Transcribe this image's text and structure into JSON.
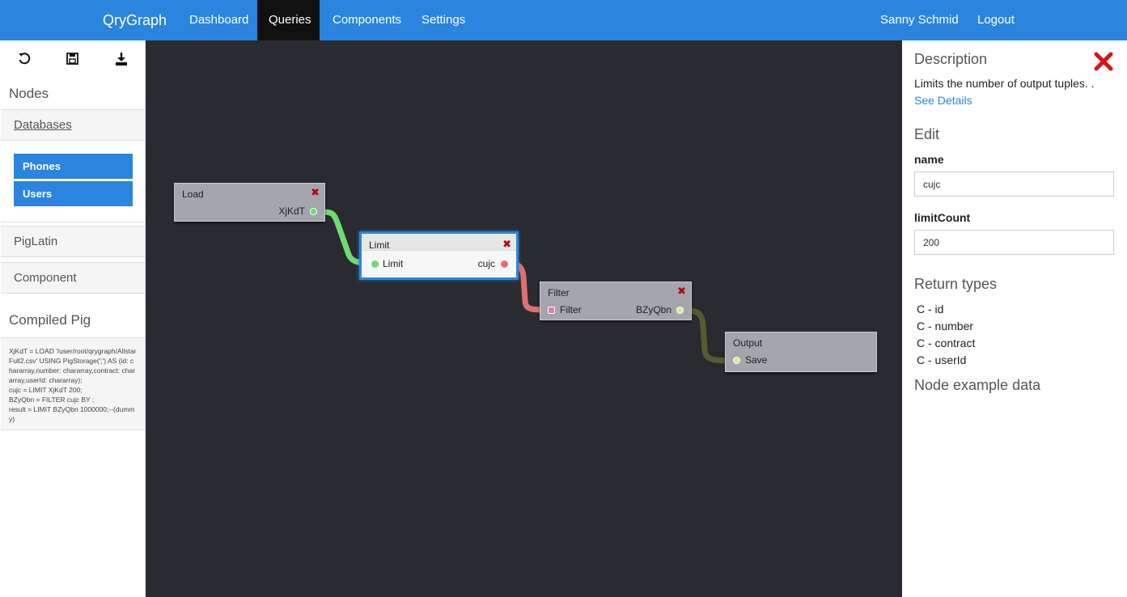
{
  "nav": {
    "brand": "QryGraph",
    "items": [
      "Dashboard",
      "Queries",
      "Components",
      "Settings"
    ],
    "active": "Queries",
    "user": "Sanny Schmid",
    "logout": "Logout"
  },
  "sidebar": {
    "toolbar": [
      "undo-icon",
      "save-icon",
      "download-icon"
    ],
    "nodes_heading": "Nodes",
    "sections": {
      "databases": "Databases",
      "piglatin": "PigLatin",
      "component": "Component"
    },
    "databases": [
      "Phones",
      "Users"
    ],
    "compiled_heading": "Compiled Pig",
    "compiled_code": "XjKdT = LOAD '/user/root/qrygraph/AllstarFull2.csv' USING PigStorage(';') AS (id: chararray,number: chararray,contract: chararray,userId: chararray);\ncujc = LIMIT XjKdT 200;\nBZyQbn = FILTER cujc BY ;\nresult = LIMIT BZyQbn 1000000;--(dummy)"
  },
  "graph": {
    "nodes": {
      "load": {
        "title": "Load",
        "out": "XjKdT"
      },
      "limit": {
        "title": "Limit",
        "in": "Limit",
        "out": "cujc"
      },
      "filter": {
        "title": "Filter",
        "in": "Filter",
        "out": "BZyQbn"
      },
      "output": {
        "title": "Output",
        "in": "Save"
      }
    },
    "close_glyph": "✖",
    "colors": {
      "green": "#6fdc6f",
      "red": "#e07070",
      "olive": "#5a5a30",
      "yellow": "#e4e48a"
    }
  },
  "panel": {
    "description_heading": "Description",
    "description": "Limits the number of output tuples. .",
    "see_details": "See Details",
    "edit_heading": "Edit",
    "name_label": "name",
    "name_value": "cujc",
    "limit_label": "limitCount",
    "limit_value": "200",
    "return_heading": "Return types",
    "return_types": [
      "C - id",
      "C - number",
      "C - contract",
      "C - userId"
    ],
    "example_heading": "Node example data"
  }
}
